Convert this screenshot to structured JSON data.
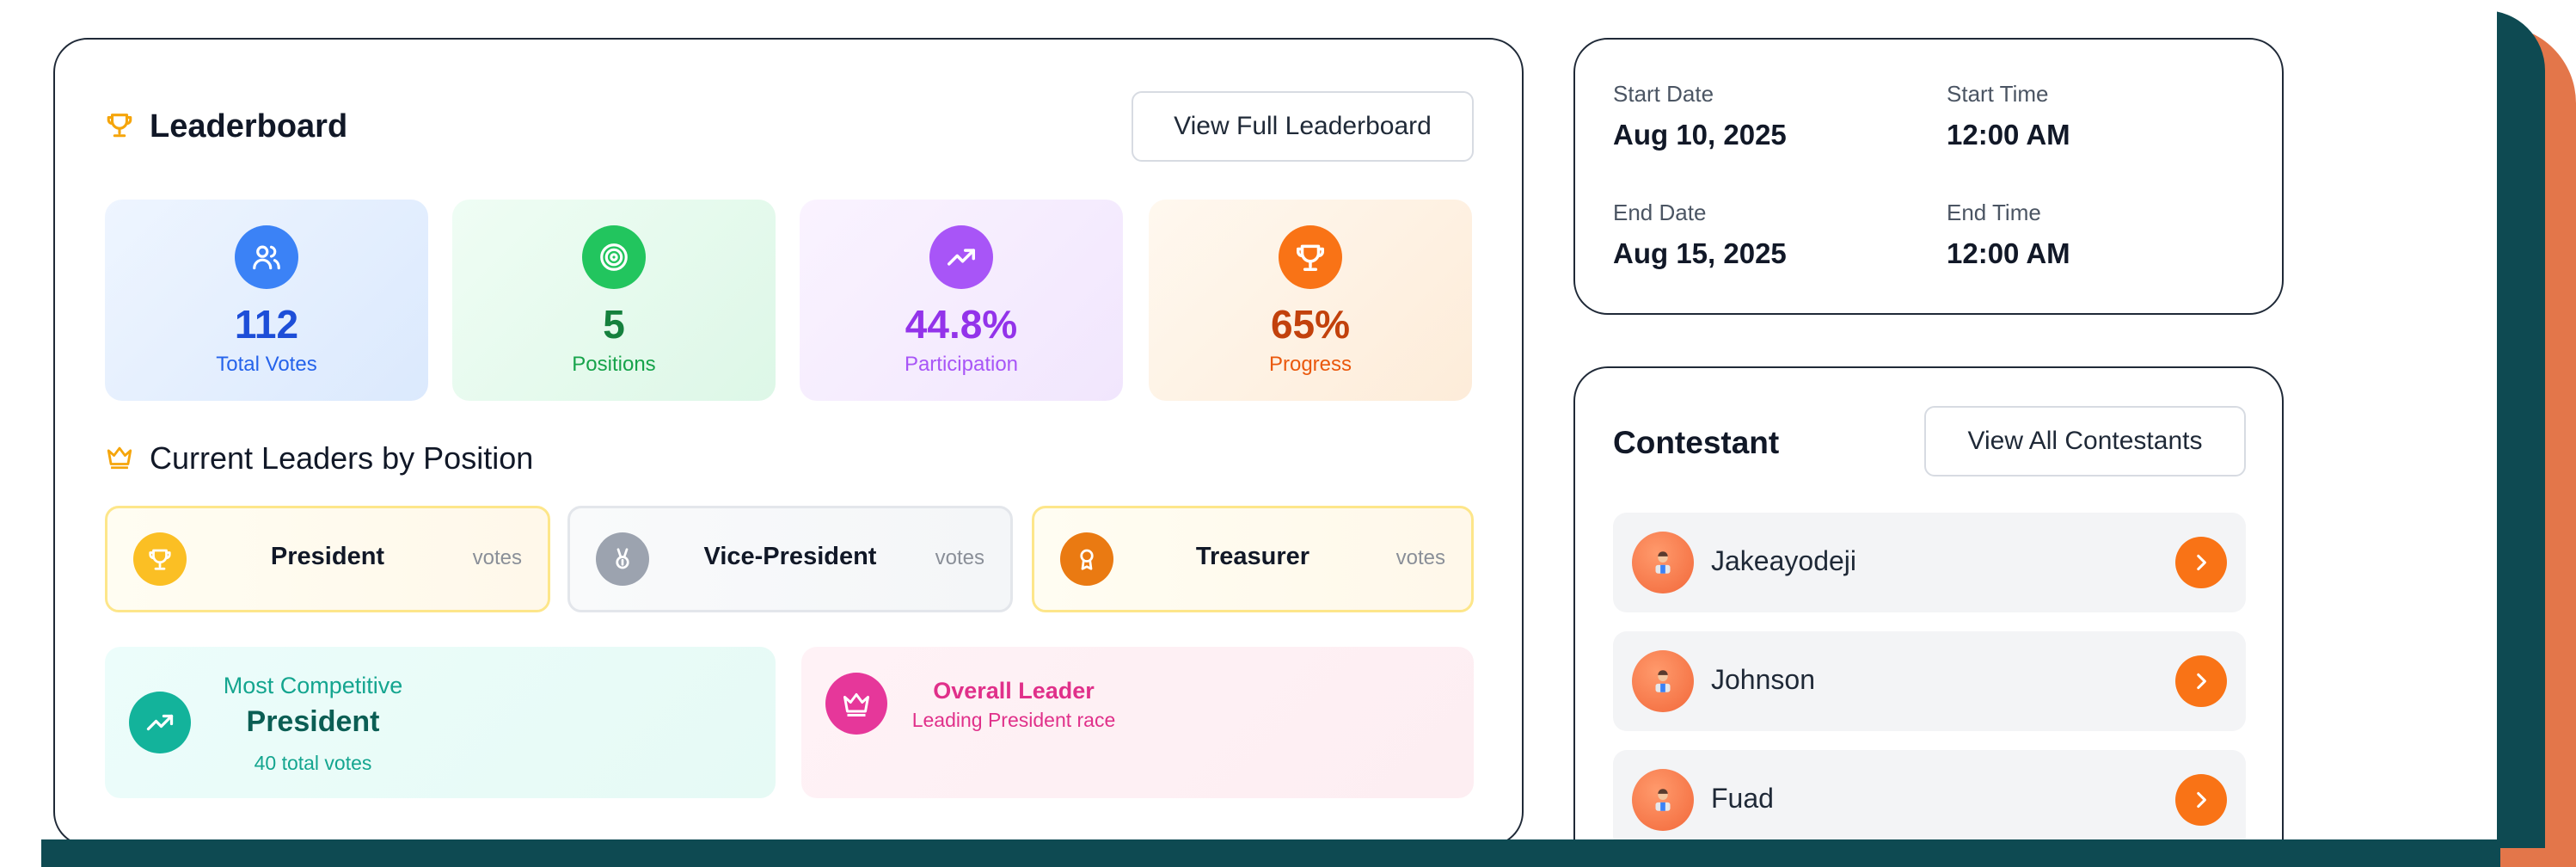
{
  "colors": {
    "accent_orange": "#f97316",
    "teal_dark": "#0e4a52",
    "backdrop_orange": "#e3764a",
    "blue": "#1d4ed8",
    "green": "#15803d",
    "purple": "#9333ea",
    "orange_red": "#c2410c"
  },
  "leaderboard": {
    "title": "Leaderboard",
    "title_icon": "trophy-icon",
    "view_full_label": "View Full Leaderboard",
    "stats": [
      {
        "value": "112",
        "label": "Total Votes",
        "icon": "users-icon"
      },
      {
        "value": "5",
        "label": "Positions",
        "icon": "target-icon"
      },
      {
        "value": "44.8%",
        "label": "Participation",
        "icon": "trending-up-icon"
      },
      {
        "value": "65%",
        "label": "Progress",
        "icon": "trophy-icon"
      }
    ],
    "leaders_heading": "Current Leaders by Position",
    "leaders_icon": "crown-icon",
    "positions": [
      {
        "name": "President",
        "votes_label": "votes",
        "icon": "trophy-icon"
      },
      {
        "name": "Vice-President",
        "votes_label": "votes",
        "icon": "medal-icon"
      },
      {
        "name": "Treasurer",
        "votes_label": "votes",
        "icon": "award-icon"
      }
    ],
    "most_competitive": {
      "label": "Most Competitive",
      "position": "President",
      "total": "40 total votes"
    },
    "overall_leader": {
      "label": "Overall Leader",
      "subtitle": "Leading President race"
    }
  },
  "schedule": {
    "start_date_label": "Start Date",
    "start_date": "Aug 10, 2025",
    "start_time_label": "Start Time",
    "start_time": "12:00 AM",
    "end_date_label": "End Date",
    "end_date": "Aug 15, 2025",
    "end_time_label": "End Time",
    "end_time": "12:00 AM"
  },
  "contestants": {
    "title": "Contestant",
    "view_all_label": "View All Contestants",
    "items": [
      {
        "name": "Jakeayodeji"
      },
      {
        "name": "Johnson"
      },
      {
        "name": "Fuad"
      }
    ]
  }
}
